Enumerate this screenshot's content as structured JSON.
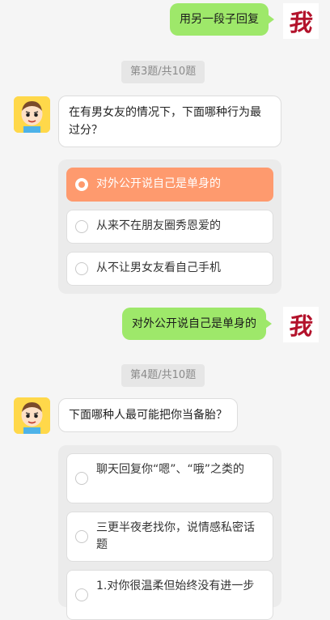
{
  "messages": {
    "reply_top": "用另一段子回复",
    "me_avatar_text": "我",
    "q3": {
      "tag": "第3题/共10题",
      "question": "在有男女友的情况下，下面哪种行为最过分？",
      "options": [
        "对外公开说自己是单身的",
        "从来不在朋友圈秀恩爱的",
        "从不让男女友看自己手机"
      ],
      "selected_index": 0
    },
    "answer_q3": "对外公开说自己是单身的",
    "q4": {
      "tag": "第4题/共10题",
      "question": "下面哪种人最可能把你当备胎？",
      "options": [
        "聊天回复你“嗯”、“哦”之类的",
        "三更半夜老找你，说情感私密话题",
        "1.对你很温柔但始终没有进一步"
      ]
    }
  },
  "colors": {
    "background": "#f5f5f5",
    "my_bubble": "#9ee86a",
    "selected_option": "#fe9a6e",
    "me_avatar_text": "#b3122b",
    "bot_avatar_bg": "#ffd84a"
  },
  "icons": {
    "bot_avatar": "cartoon-boy-avatar",
    "me_avatar": "wo-character-avatar"
  }
}
